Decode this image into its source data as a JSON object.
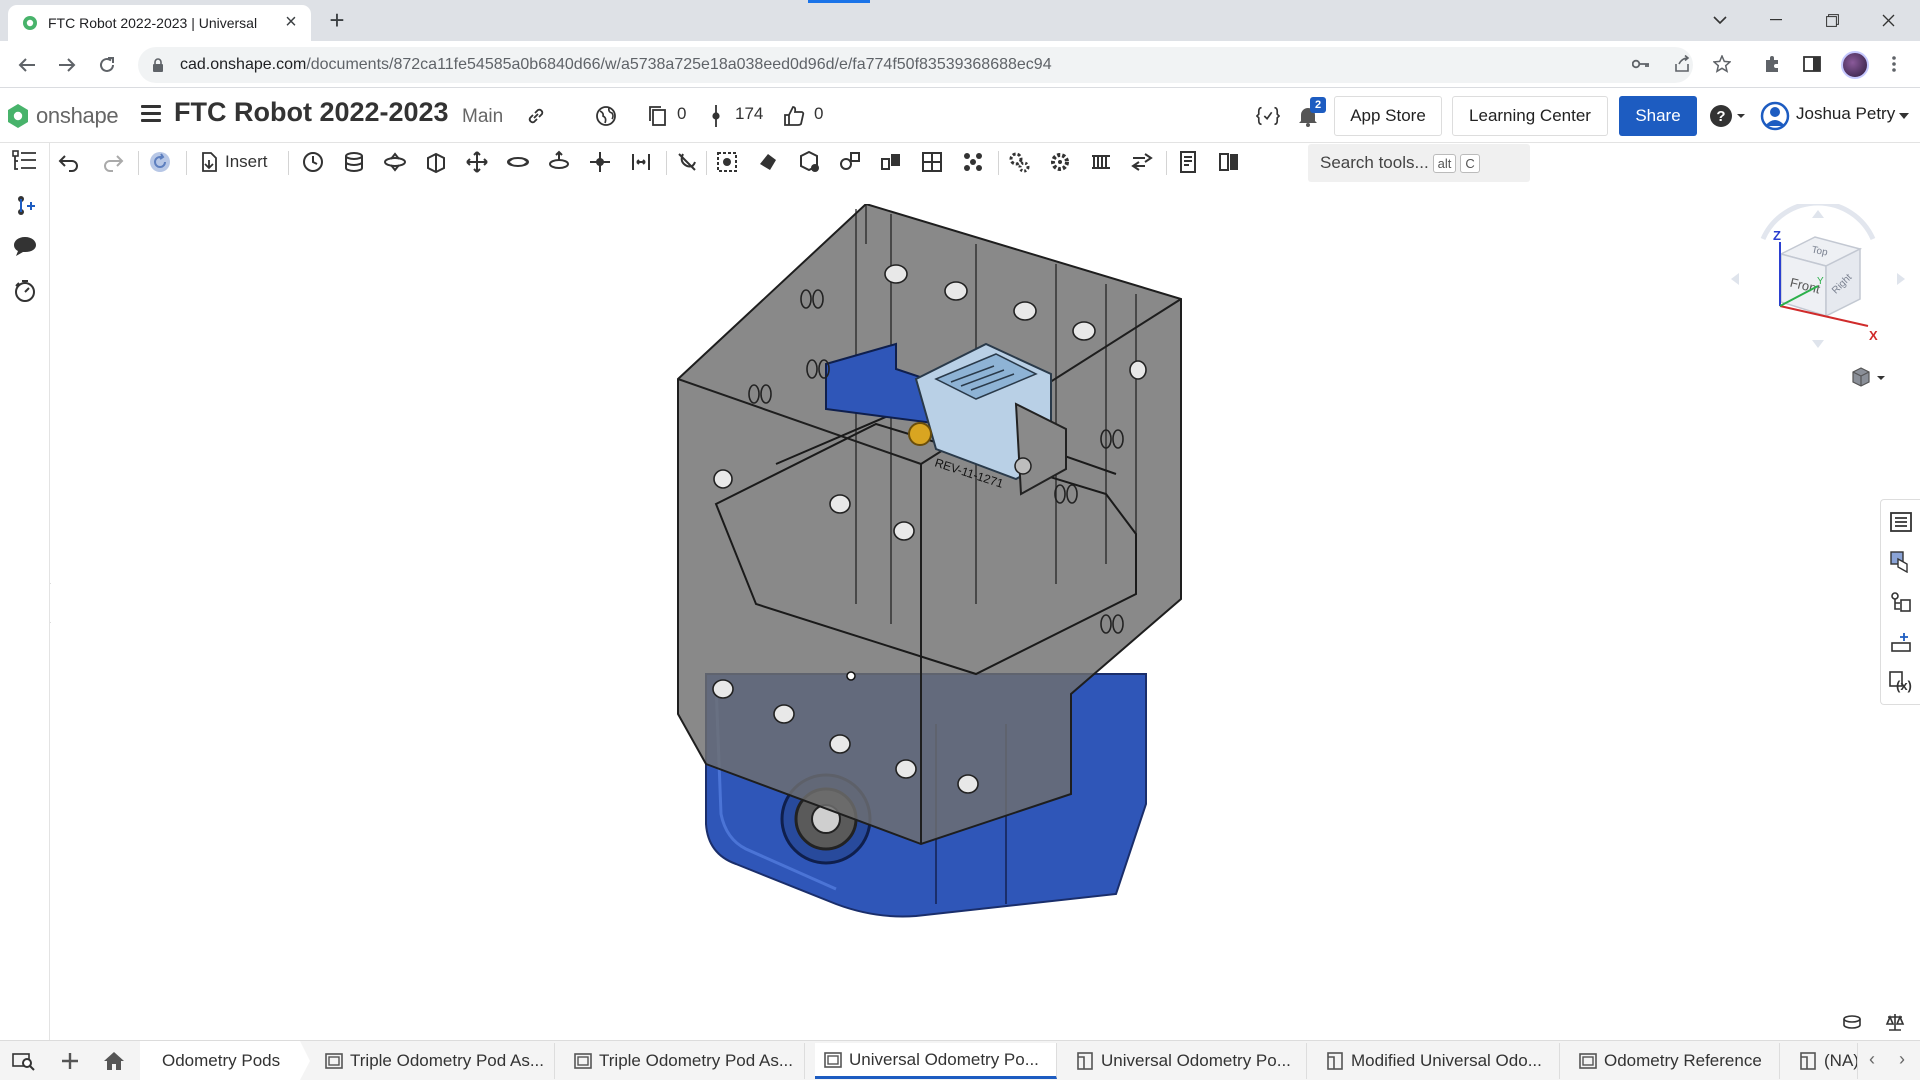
{
  "browser": {
    "tab_title": "FTC Robot 2022-2023 | Universal",
    "url_host": "cad.onshape.com",
    "url_path": "/documents/872ca11fe54585a0b6840d66/w/a5738a725e18a038eed0d96d/e/fa774f50f83539368688ec94"
  },
  "header": {
    "brand": "onshape",
    "doc_title": "FTC Robot 2022-2023",
    "branch": "Main",
    "copies_count": "0",
    "versions_count": "174",
    "likes_count": "0",
    "notifications_count": "2",
    "app_store": "App Store",
    "learning_center": "Learning Center",
    "share": "Share",
    "help_icon": "?",
    "user": "Joshua Petry"
  },
  "toolbar": {
    "insert": "Insert",
    "search_placeholder": "Search tools...",
    "search_shortcut_mod": "alt",
    "search_shortcut_key": "C"
  },
  "viewcube": {
    "top": "Top",
    "front": "Front",
    "right": "Right",
    "axis_x": "X",
    "axis_y": "Y",
    "axis_z": "Z"
  },
  "model": {
    "engraving": "REV-11-1271"
  },
  "bottom": {
    "folder": "Odometry Pods",
    "tabs": [
      {
        "label": "Triple Odometry Pod As...",
        "type": "assembly"
      },
      {
        "label": "Triple Odometry Pod As...",
        "type": "assembly"
      },
      {
        "label": "Universal Odometry Po...",
        "type": "assembly",
        "active": true
      },
      {
        "label": "Universal Odometry Po...",
        "type": "drawing"
      },
      {
        "label": "Modified Universal Odo...",
        "type": "drawing"
      },
      {
        "label": "Odometry Reference",
        "type": "assembly"
      },
      {
        "label": "(NA)",
        "type": "drawing"
      }
    ]
  },
  "colors": {
    "accent": "#1d5cc1",
    "model_blue": "#2f56b8",
    "housing_gray": "#6b6b6b"
  }
}
